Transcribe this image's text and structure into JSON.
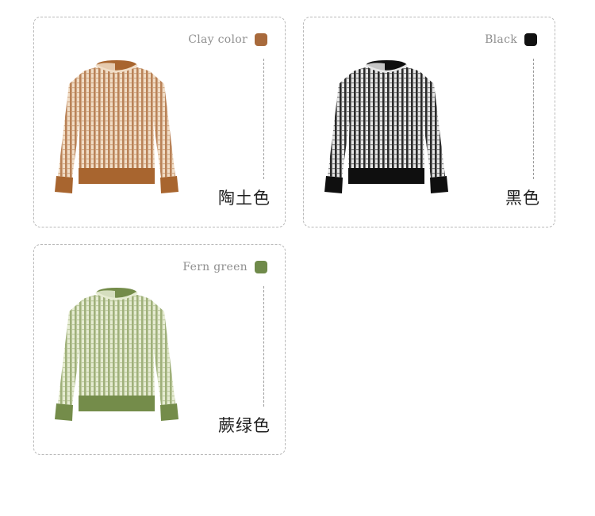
{
  "colors": [
    {
      "en": "Clay color",
      "cn": "陶土色",
      "swatch": "#a86a3c",
      "body_light": "#f1ddc6",
      "body_dark": "#b98257",
      "trim": "#a8652f",
      "garment_icon": "clay-sweater-image"
    },
    {
      "en": "Black",
      "cn": "黑色",
      "swatch": "#111111",
      "body_light": "#e6e6e6",
      "body_dark": "#2a2a2a",
      "trim": "#0f0f0f",
      "garment_icon": "black-sweater-image"
    },
    {
      "en": "Fern green",
      "cn": "蕨绿色",
      "swatch": "#6f8a4a",
      "body_light": "#e6ecd2",
      "body_dark": "#9fb07a",
      "trim": "#748c4a",
      "garment_icon": "fern-green-sweater-image"
    }
  ]
}
